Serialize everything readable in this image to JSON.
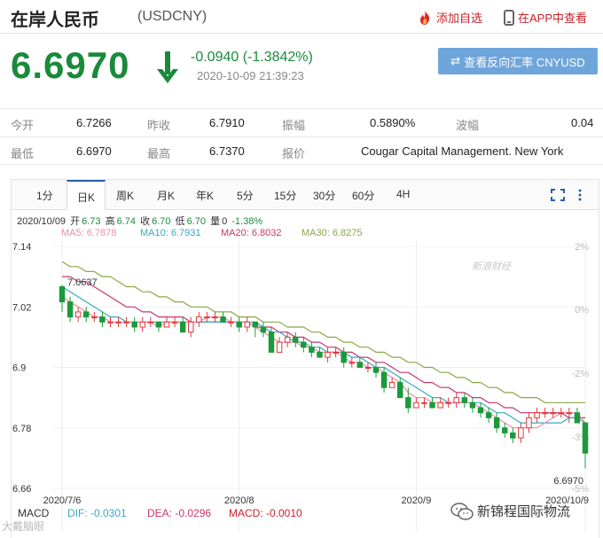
{
  "header": {
    "title": "在岸人民币",
    "code": "(USDCNY)",
    "add_favorite": "添加自选",
    "app_view": "在APP中查看"
  },
  "quote": {
    "price": "6.6970",
    "change": "-0.0940 (-1.3842%)",
    "timestamp": "2020-10-09 21:39:23",
    "reverse_button": "查看反向汇率 CNYUSD",
    "color_down": "#1a8a3a"
  },
  "stats": [
    [
      {
        "label": "今开",
        "value": "6.7266"
      },
      {
        "label": "昨收",
        "value": "6.7910"
      },
      {
        "label": "振幅",
        "value": "0.5890%"
      },
      {
        "label": "波幅",
        "value": "0.04"
      }
    ],
    [
      {
        "label": "最低",
        "value": "6.6970"
      },
      {
        "label": "最高",
        "value": "6.7370"
      },
      {
        "label": "报价",
        "value": "Cougar Capital Management. New York"
      }
    ]
  ],
  "tabs": [
    "1分",
    "日K",
    "周K",
    "月K",
    "年K",
    "5分",
    "15分",
    "30分",
    "60分",
    "4H"
  ],
  "active_tab": "日K",
  "ohlc": {
    "date": "2020/10/09",
    "open_label": "开",
    "open": "6.73",
    "high_label": "高",
    "high": "6.74",
    "close_label": "收",
    "close": "6.70",
    "low_label": "低",
    "low": "6.70",
    "vol_label": "量",
    "vol": "0",
    "change": "-1.38%"
  },
  "ma": {
    "ma5": "MA5: 6.7878",
    "ma10": "MA10: 6.7931",
    "ma20": "MA20: 6.8032",
    "ma30": "MA30: 6.8275",
    "colors": {
      "ma5": "#e88fa8",
      "ma10": "#3aa7c4",
      "ma20": "#c9366e",
      "ma30": "#8aa843"
    }
  },
  "watermark": "新浪财经",
  "macd": {
    "label": "MACD",
    "dif": "DIF: -0.0301",
    "dea": "DEA: -0.0296",
    "macd": "MACD: -0.0010"
  },
  "bottom_watermark": "大戴脑眼",
  "wechat_source": "新锦程国际物流",
  "chart_data": {
    "type": "candlestick",
    "yticks": [
      "7.14",
      "7.02",
      "6.9",
      "6.78",
      "6.66"
    ],
    "ylim": [
      6.66,
      7.14
    ],
    "pct_ticks": [
      "2%",
      "0%",
      "-2%",
      "-3%",
      "-5%"
    ],
    "xticks": [
      "2020/7/6",
      "2020/8",
      "2020/9",
      "2020/10/9"
    ],
    "annotations": {
      "max_label": "7.0637",
      "last_label": "6.6970"
    },
    "candles": [
      [
        7.06,
        7.03,
        7.064,
        7.01
      ],
      [
        7.03,
        7.0,
        7.04,
        6.99
      ],
      [
        7.0,
        7.01,
        7.02,
        6.99
      ],
      [
        7.01,
        7.0,
        7.02,
        6.99
      ],
      [
        7.0,
        7.0,
        7.01,
        6.99
      ],
      [
        7.0,
        6.99,
        7.01,
        6.98
      ],
      [
        6.99,
        6.99,
        7.0,
        6.98
      ],
      [
        6.99,
        6.99,
        7.0,
        6.98
      ],
      [
        6.99,
        6.99,
        7.0,
        6.98
      ],
      [
        6.99,
        6.98,
        7.0,
        6.97
      ],
      [
        6.98,
        6.99,
        7.0,
        6.97
      ],
      [
        6.99,
        6.99,
        7.0,
        6.98
      ],
      [
        6.99,
        6.98,
        6.99,
        6.97
      ],
      [
        6.98,
        6.99,
        7.0,
        6.98
      ],
      [
        6.99,
        6.99,
        7.0,
        6.98
      ],
      [
        6.99,
        6.97,
        7.0,
        6.97
      ],
      [
        6.97,
        6.99,
        7.0,
        6.96
      ],
      [
        6.99,
        7.0,
        7.01,
        6.98
      ],
      [
        7.0,
        7.0,
        7.01,
        6.99
      ],
      [
        7.0,
        7.0,
        7.01,
        6.99
      ],
      [
        7.0,
        6.99,
        7.01,
        6.99
      ],
      [
        6.99,
        6.99,
        7.0,
        6.98
      ],
      [
        6.99,
        6.98,
        7.0,
        6.97
      ],
      [
        6.98,
        6.99,
        7.0,
        6.97
      ],
      [
        6.99,
        6.98,
        6.99,
        6.96
      ],
      [
        6.98,
        6.97,
        6.99,
        6.96
      ],
      [
        6.97,
        6.93,
        6.98,
        6.93
      ],
      [
        6.93,
        6.95,
        6.96,
        6.93
      ],
      [
        6.95,
        6.96,
        6.97,
        6.94
      ],
      [
        6.96,
        6.95,
        6.97,
        6.94
      ],
      [
        6.95,
        6.94,
        6.96,
        6.93
      ],
      [
        6.94,
        6.93,
        6.95,
        6.92
      ],
      [
        6.93,
        6.92,
        6.94,
        6.92
      ],
      [
        6.92,
        6.93,
        6.94,
        6.91
      ],
      [
        6.93,
        6.93,
        6.94,
        6.92
      ],
      [
        6.93,
        6.91,
        6.94,
        6.9
      ],
      [
        6.91,
        6.91,
        6.92,
        6.9
      ],
      [
        6.91,
        6.9,
        6.92,
        6.9
      ],
      [
        6.9,
        6.9,
        6.91,
        6.89
      ],
      [
        6.9,
        6.89,
        6.91,
        6.88
      ],
      [
        6.89,
        6.86,
        6.9,
        6.85
      ],
      [
        6.86,
        6.87,
        6.88,
        6.86
      ],
      [
        6.87,
        6.84,
        6.88,
        6.84
      ],
      [
        6.84,
        6.82,
        6.86,
        6.81
      ],
      [
        6.82,
        6.83,
        6.84,
        6.82
      ],
      [
        6.83,
        6.83,
        6.84,
        6.82
      ],
      [
        6.83,
        6.82,
        6.84,
        6.82
      ],
      [
        6.82,
        6.83,
        6.84,
        6.82
      ],
      [
        6.83,
        6.83,
        6.84,
        6.82
      ],
      [
        6.83,
        6.84,
        6.85,
        6.82
      ],
      [
        6.84,
        6.83,
        6.85,
        6.82
      ],
      [
        6.83,
        6.82,
        6.84,
        6.81
      ],
      [
        6.82,
        6.81,
        6.83,
        6.8
      ],
      [
        6.81,
        6.8,
        6.82,
        6.79
      ],
      [
        6.8,
        6.78,
        6.81,
        6.77
      ],
      [
        6.78,
        6.77,
        6.79,
        6.76
      ],
      [
        6.77,
        6.76,
        6.78,
        6.75
      ],
      [
        6.76,
        6.78,
        6.79,
        6.75
      ],
      [
        6.78,
        6.8,
        6.81,
        6.77
      ],
      [
        6.8,
        6.81,
        6.82,
        6.79
      ],
      [
        6.81,
        6.81,
        6.82,
        6.8
      ],
      [
        6.81,
        6.81,
        6.82,
        6.8
      ],
      [
        6.81,
        6.81,
        6.82,
        6.8
      ],
      [
        6.81,
        6.81,
        6.82,
        6.79
      ],
      [
        6.81,
        6.79,
        6.82,
        6.79
      ],
      [
        6.79,
        6.73,
        6.74,
        6.7
      ]
    ],
    "ma5": [
      7.04,
      7.03,
      7.02,
      7.01,
      7.0,
      7.0,
      6.99,
      6.99,
      6.99,
      6.99,
      6.99,
      6.99,
      6.98,
      6.99,
      6.99,
      6.99,
      6.99,
      6.99,
      7.0,
      7.0,
      7.0,
      6.99,
      6.99,
      6.99,
      6.98,
      6.97,
      6.96,
      6.95,
      6.95,
      6.95,
      6.94,
      6.94,
      6.93,
      6.93,
      6.93,
      6.92,
      6.91,
      6.91,
      6.9,
      6.9,
      6.89,
      6.88,
      6.87,
      6.85,
      6.84,
      6.84,
      6.83,
      6.83,
      6.83,
      6.83,
      6.83,
      6.83,
      6.82,
      6.81,
      6.8,
      6.79,
      6.78,
      6.78,
      6.78,
      6.78,
      6.79,
      6.8,
      6.81,
      6.81,
      6.81,
      6.79
    ],
    "ma10": [
      7.06,
      7.05,
      7.04,
      7.03,
      7.02,
      7.01,
      7.0,
      7.0,
      6.99,
      6.99,
      6.99,
      6.99,
      6.99,
      6.99,
      6.99,
      6.99,
      6.99,
      6.99,
      6.99,
      6.99,
      6.99,
      6.99,
      6.99,
      6.99,
      6.99,
      6.98,
      6.97,
      6.97,
      6.96,
      6.95,
      6.95,
      6.94,
      6.94,
      6.93,
      6.93,
      6.93,
      6.92,
      6.92,
      6.91,
      6.9,
      6.9,
      6.89,
      6.88,
      6.87,
      6.86,
      6.85,
      6.84,
      6.84,
      6.83,
      6.83,
      6.83,
      6.83,
      6.83,
      6.82,
      6.81,
      6.81,
      6.8,
      6.79,
      6.79,
      6.79,
      6.79,
      6.79,
      6.79,
      6.8,
      6.8,
      6.79
    ],
    "ma20": [
      7.08,
      7.08,
      7.07,
      7.07,
      7.06,
      7.05,
      7.04,
      7.03,
      7.02,
      7.02,
      7.01,
      7.01,
      7.0,
      7.0,
      7.0,
      7.0,
      6.99,
      6.99,
      6.99,
      6.99,
      6.99,
      6.99,
      6.99,
      6.99,
      6.98,
      6.98,
      6.98,
      6.97,
      6.97,
      6.96,
      6.96,
      6.95,
      6.95,
      6.94,
      6.94,
      6.93,
      6.93,
      6.92,
      6.92,
      6.91,
      6.91,
      6.9,
      6.89,
      6.89,
      6.88,
      6.87,
      6.87,
      6.86,
      6.86,
      6.85,
      6.85,
      6.84,
      6.84,
      6.83,
      6.83,
      6.82,
      6.82,
      6.81,
      6.81,
      6.81,
      6.81,
      6.81,
      6.81,
      6.8,
      6.8,
      6.8
    ],
    "ma30": [
      7.11,
      7.1,
      7.1,
      7.09,
      7.09,
      7.08,
      7.08,
      7.07,
      7.06,
      7.06,
      7.05,
      7.05,
      7.04,
      7.04,
      7.03,
      7.03,
      7.02,
      7.02,
      7.02,
      7.01,
      7.01,
      7.01,
      7.0,
      7.0,
      7.0,
      6.99,
      6.99,
      6.99,
      6.98,
      6.98,
      6.98,
      6.97,
      6.97,
      6.96,
      6.96,
      6.95,
      6.95,
      6.94,
      6.94,
      6.93,
      6.93,
      6.92,
      6.92,
      6.91,
      6.91,
      6.9,
      6.9,
      6.89,
      6.89,
      6.88,
      6.88,
      6.87,
      6.87,
      6.86,
      6.86,
      6.85,
      6.85,
      6.84,
      6.84,
      6.84,
      6.83,
      6.83,
      6.83,
      6.83,
      6.83,
      6.83
    ],
    "colors": {
      "up": "#e03838",
      "down": "#1a9a3a"
    }
  }
}
